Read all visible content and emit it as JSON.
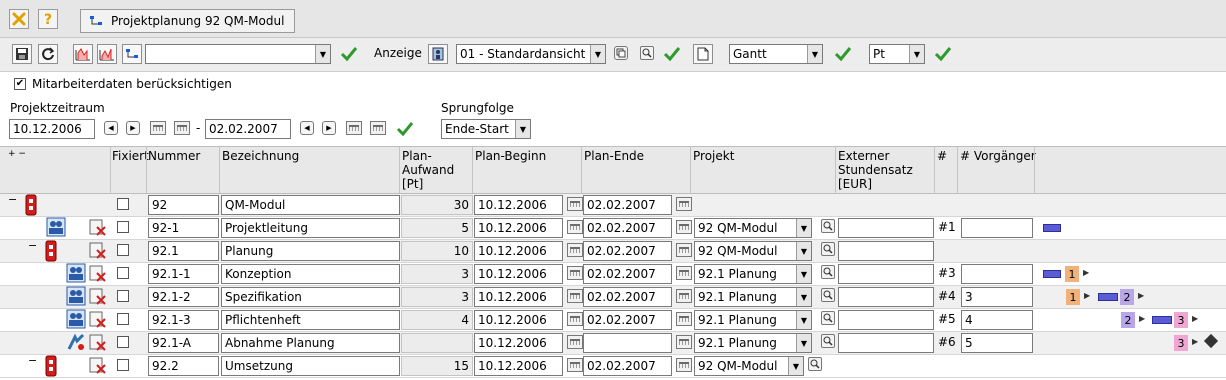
{
  "window": {
    "tab_title": "Projektplanung 92 QM-Modul"
  },
  "toolbar": {
    "project_select_value": "",
    "anzeige_label": "Anzeige",
    "view_select_value": "01 - Standardansicht",
    "mode_select_value": "Gantt",
    "unit_select_value": "Pt"
  },
  "options": {
    "mitarbeiter_label": "Mitarbeiterdaten berücksichtigen",
    "mitarbeiter_checked": true
  },
  "range": {
    "label": "Projektzeitraum",
    "start": "10.12.2006",
    "separator": "-",
    "end": "02.02.2007"
  },
  "sprung": {
    "label": "Sprungfolge",
    "value": "Ende-Start"
  },
  "grid": {
    "expand_collapse": "+ −",
    "headers": {
      "fixiert": "Fixiert",
      "nummer": "Nummer",
      "bezeichnung": "Bezeichnung",
      "aufwand_l1": "Plan-",
      "aufwand_l2": "Aufwand",
      "aufwand_l3": "[Pt]",
      "beginn": "Plan-Beginn",
      "ende": "Plan-Ende",
      "projekt": "Projekt",
      "satz_l1": "Externer",
      "satz_l2": "Stundensatz",
      "satz_l3": "[EUR]",
      "hash": "#",
      "vorgaenger": "# Vorgänger"
    },
    "rows": [
      {
        "nummer": "92",
        "bezeichnung": "QM-Modul",
        "aufwand": "30",
        "beginn": "10.12.2006",
        "ende": "02.02.2007",
        "projekt": "",
        "satz": "",
        "hash": "",
        "vorgaenger": ""
      },
      {
        "nummer": "92-1",
        "bezeichnung": "Projektleitung",
        "aufwand": "5",
        "beginn": "10.12.2006",
        "ende": "02.02.2007",
        "projekt": "92 QM-Modul",
        "satz": "",
        "hash": "#1",
        "vorgaenger": ""
      },
      {
        "nummer": "92.1",
        "bezeichnung": "Planung",
        "aufwand": "10",
        "beginn": "10.12.2006",
        "ende": "02.02.2007",
        "projekt": "92 QM-Modul",
        "satz": "",
        "hash": "",
        "vorgaenger": ""
      },
      {
        "nummer": "92.1-1",
        "bezeichnung": "Konzeption",
        "aufwand": "3",
        "beginn": "10.12.2006",
        "ende": "02.02.2007",
        "projekt": "92.1 Planung",
        "satz": "",
        "hash": "#3",
        "vorgaenger": ""
      },
      {
        "nummer": "92.1-2",
        "bezeichnung": "Spezifikation",
        "aufwand": "3",
        "beginn": "10.12.2006",
        "ende": "02.02.2007",
        "projekt": "92.1 Planung",
        "satz": "",
        "hash": "#4",
        "vorgaenger": "3"
      },
      {
        "nummer": "92.1-3",
        "bezeichnung": "Pflichtenheft",
        "aufwand": "4",
        "beginn": "10.12.2006",
        "ende": "02.02.2007",
        "projekt": "92.1 Planung",
        "satz": "",
        "hash": "#5",
        "vorgaenger": "4"
      },
      {
        "nummer": "92.1-A",
        "bezeichnung": "Abnahme Planung",
        "aufwand": "",
        "beginn": "10.12.2006",
        "ende": "",
        "projekt": "92.1 Planung",
        "satz": "",
        "hash": "#6",
        "vorgaenger": "5"
      },
      {
        "nummer": "92.2",
        "bezeichnung": "Umsetzung",
        "aufwand": "15",
        "beginn": "10.12.2006",
        "ende": "02.02.2007",
        "projekt": "92 QM-Modul",
        "satz": "",
        "hash": "",
        "vorgaenger": ""
      }
    ],
    "gantt_labels": {
      "k1": "1",
      "s1": "1",
      "s2": "2",
      "p2": "2",
      "p3": "3",
      "a3": "3"
    }
  },
  "colors": {
    "gantt_bar": "#5b5bd6",
    "box_orange": "#f0b27a",
    "box_purple": "#b9a6e6",
    "box_pink": "#f0a6d2",
    "check_green": "#2e9a2e"
  }
}
